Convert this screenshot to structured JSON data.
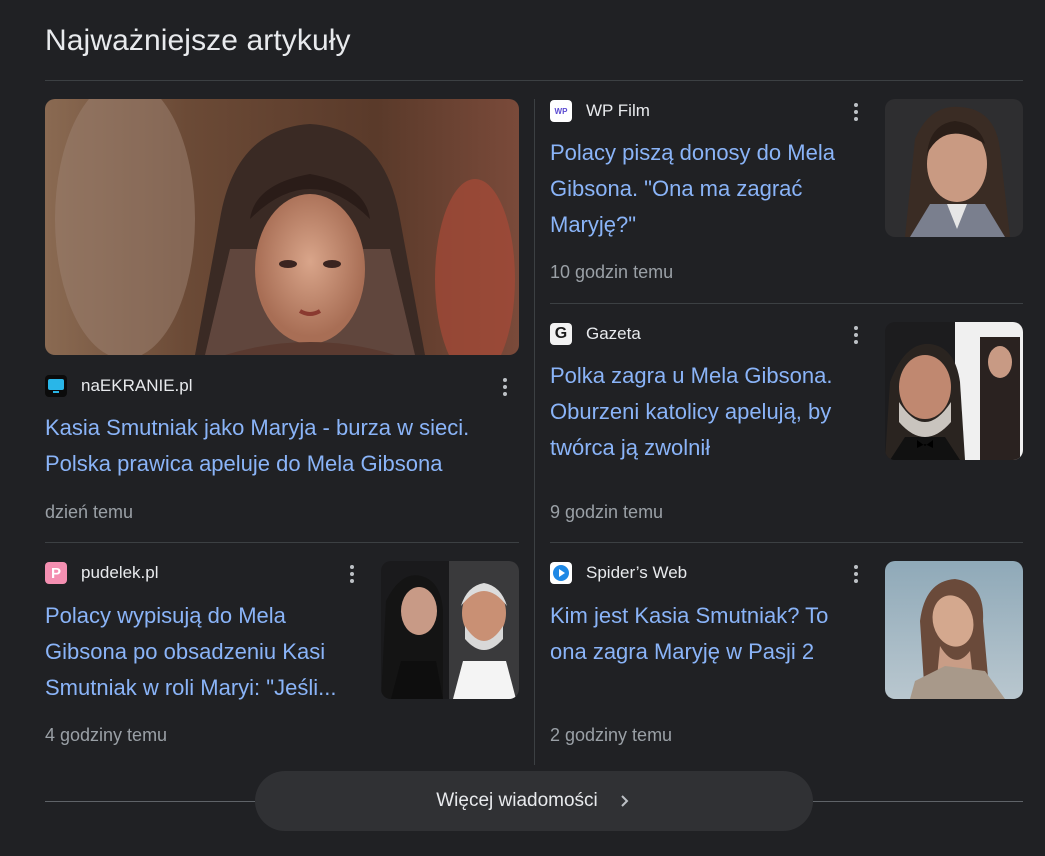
{
  "section": {
    "title": "Najważniejsze artykuły"
  },
  "articles": {
    "featured": {
      "source": "naEKRANIE.pl",
      "headline": "Kasia Smutniak jako Maryja - burza w sieci. Polska prawica apeluje do Mela Gibsona",
      "time": "dzień temu"
    },
    "wpfilm": {
      "source": "WP Film",
      "headline": "Polacy piszą donosy do Mela Gibsona. \"Ona ma zagrać Maryję?\"",
      "time": "10 godzin temu"
    },
    "gazeta": {
      "source": "Gazeta",
      "headline": "Polka zagra u Mela Gibsona. Oburzeni katolicy apelują, by twórca ją zwolnił",
      "time": "9 godzin temu"
    },
    "pudelek": {
      "source": "pudelek.pl",
      "headline": "Polacy wypisują do Mela Gibsona po obsadzeniu Kasi Smutniak w roli Maryi: \"Jeśli...",
      "time": "4 godziny temu"
    },
    "spidersweb": {
      "source": "Spider’s Web",
      "headline": "Kim jest Kasia Smutniak? To ona zagra Maryję w Pasji 2",
      "time": "2 godziny temu"
    }
  },
  "favicon_text": {
    "wpfilm": "WP",
    "gazeta": "G",
    "pudelek": "P"
  },
  "footer": {
    "more_news_label": "Więcej wiadomości"
  },
  "colors": {
    "background": "#202124",
    "link": "#8ab4f8",
    "muted": "#9aa0a6",
    "divider": "#3c4043"
  }
}
